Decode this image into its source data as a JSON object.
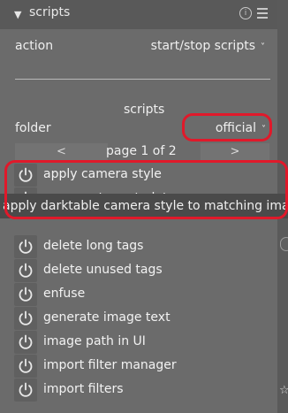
{
  "module": {
    "title": "scripts"
  },
  "action": {
    "label": "action",
    "value": "start/stop scripts"
  },
  "section": {
    "title": "scripts"
  },
  "folder": {
    "label": "folder",
    "value": "official"
  },
  "pager": {
    "prev": "<",
    "text": "page 1 of 2",
    "next": ">"
  },
  "scripts": [
    {
      "label": "apply camera style"
    },
    {
      "label": "copy paste metadata"
    },
    {
      "label": "delete long tags"
    },
    {
      "label": "delete unused tags"
    },
    {
      "label": "enfuse"
    },
    {
      "label": "generate image text"
    },
    {
      "label": "image path in UI"
    },
    {
      "label": "import filter manager"
    },
    {
      "label": "import filters"
    }
  ],
  "tooltip": {
    "text": "apply darktable camera style to matching images"
  },
  "icons": {
    "collapse": "chevron-down-icon",
    "info": "info-icon",
    "presets": "menu-icon",
    "power": "power-icon",
    "star": "star-icon"
  },
  "colors": {
    "highlight": "#e0192a"
  }
}
